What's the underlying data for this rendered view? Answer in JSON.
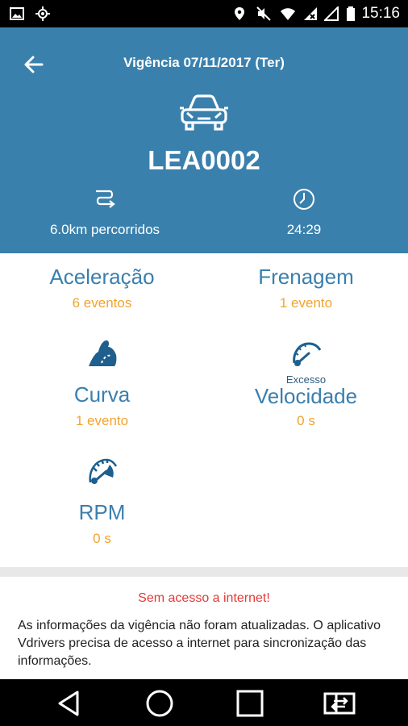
{
  "status_bar": {
    "time": "15:16"
  },
  "header": {
    "title": "Vigência 07/11/2017 (Ter)",
    "plate": "LEA0002",
    "distance": "6.0km percorridos",
    "duration": "24:29"
  },
  "cards": {
    "aceleracao": {
      "title": "Aceleração",
      "value": "6 eventos"
    },
    "frenagem": {
      "title": "Frenagem",
      "value": "1 evento"
    },
    "curva": {
      "title": "Curva",
      "value": "1 evento"
    },
    "velocidade": {
      "prefix": "Excesso",
      "title": "Velocidade",
      "value": "0 s"
    },
    "rpm": {
      "title": "RPM",
      "value": "0 s"
    }
  },
  "warning": {
    "title": "Sem acesso a internet!",
    "body": "As informações da vigência não foram atualizadas. O aplicativo Vdrivers precisa de acesso a internet para sincronização das informações."
  },
  "colors": {
    "header_bg": "#3a80ac",
    "accent": "#3a7fae",
    "value": "#f2a32d",
    "warning": "#e53935"
  }
}
